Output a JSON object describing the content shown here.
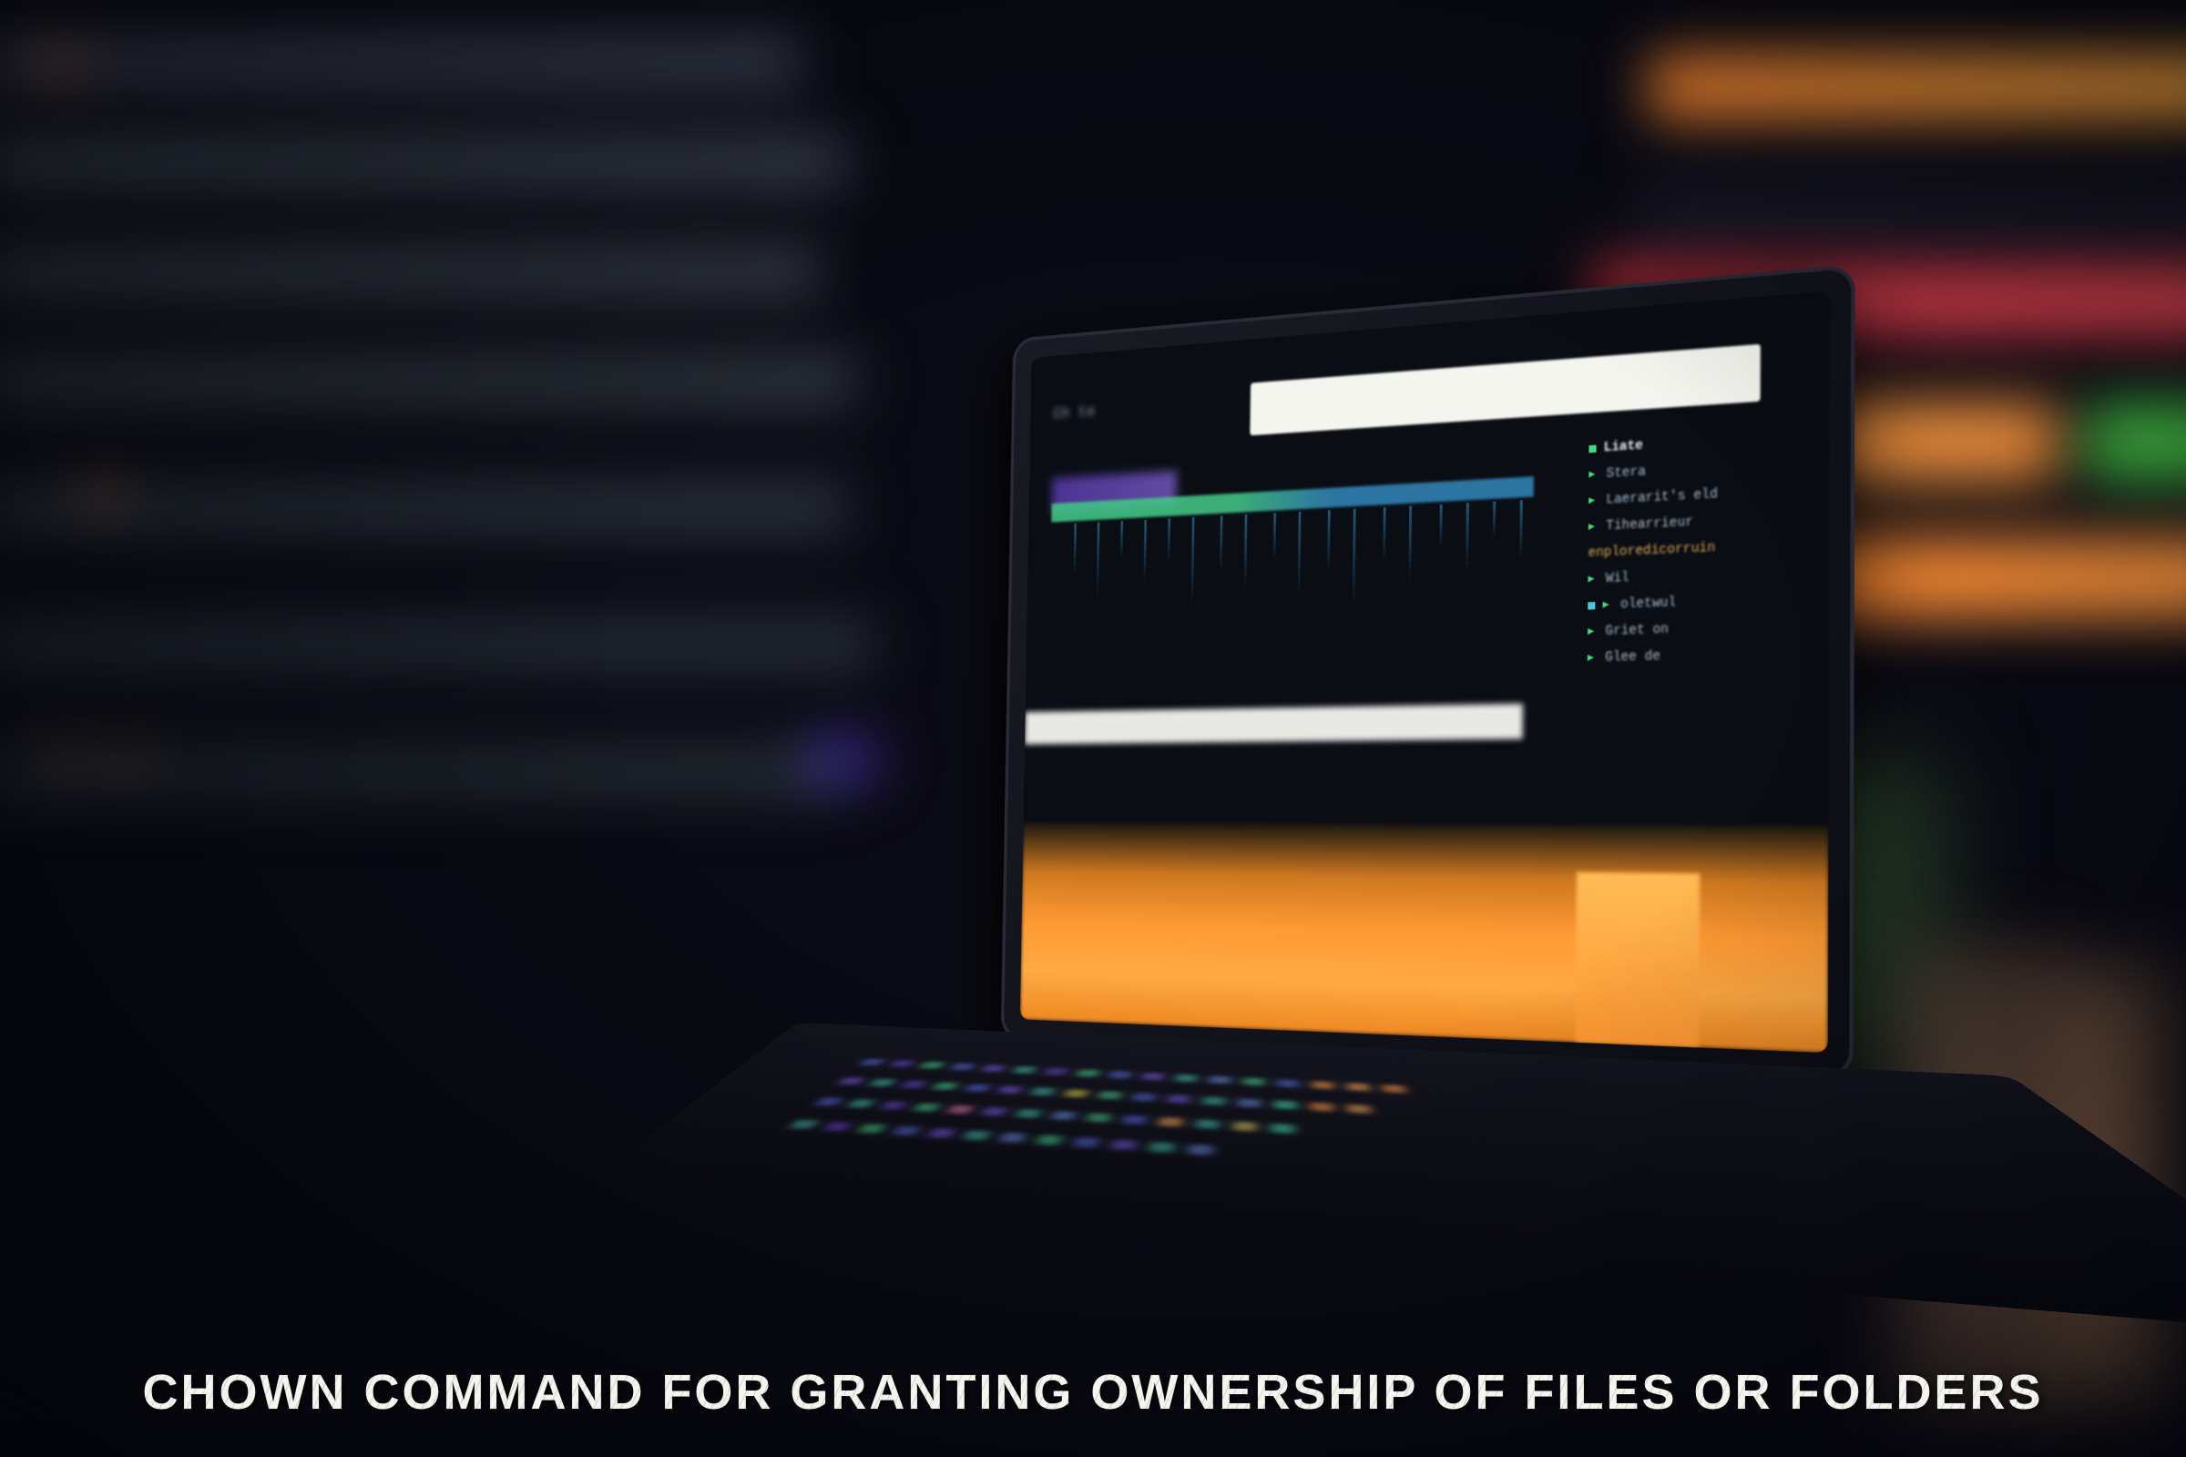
{
  "caption": "CHOWN  COMMAND FOR GRANTING OWNERSHIP OF FILES OR FOLDERS",
  "screen_panel": {
    "items": [
      {
        "label": "Liate",
        "highlighted": true
      },
      {
        "label": "Stera"
      },
      {
        "label": "Laerarit's eld"
      },
      {
        "label": "Tihearrieur"
      },
      {
        "label": "enploredicorruin"
      },
      {
        "label": "Wil"
      },
      {
        "label": "oletwul"
      },
      {
        "label": "Griet on"
      },
      {
        "label": "Glee de"
      }
    ]
  },
  "screen_top_label": "Ch ta"
}
